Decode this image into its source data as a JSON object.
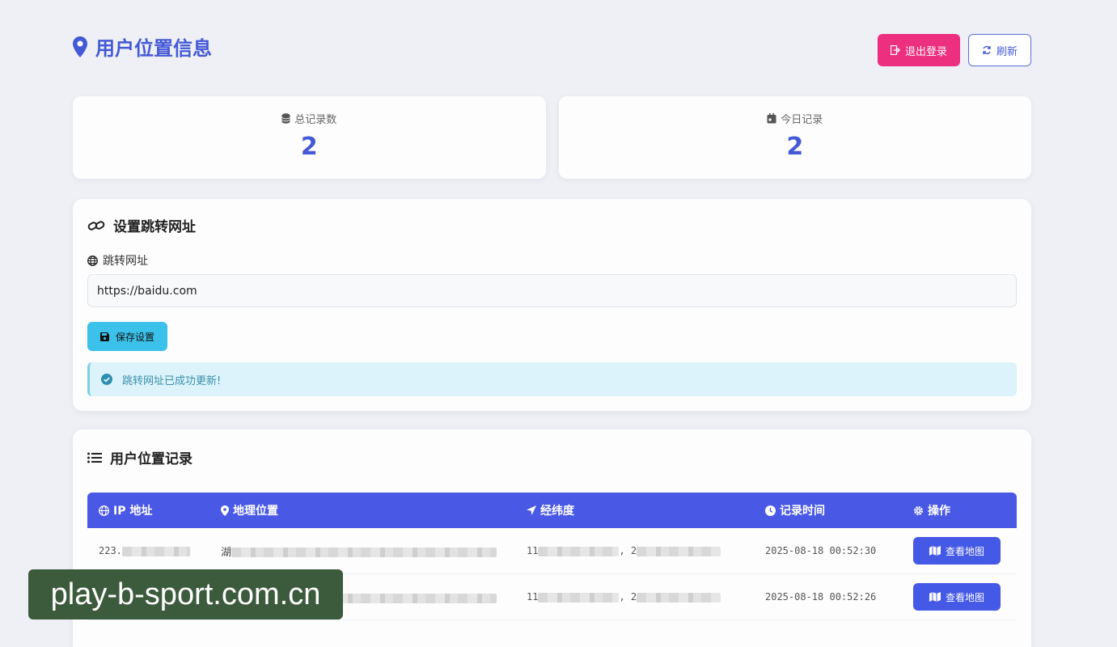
{
  "header": {
    "title": "用户位置信息",
    "logout_label": "退出登录",
    "refresh_label": "刷新"
  },
  "stats": [
    {
      "label": "总记录数",
      "value": "2",
      "icon": "database-icon"
    },
    {
      "label": "今日记录",
      "value": "2",
      "icon": "calendar-icon"
    }
  ],
  "redirect": {
    "title": "设置跳转网址",
    "field_label": "跳转网址",
    "url_value": "https://baidu.com",
    "save_label": "保存设置",
    "alert_text": "跳转网址已成功更新!"
  },
  "records": {
    "title": "用户位置记录",
    "columns": [
      "IP 地址",
      "地理位置",
      "经纬度",
      "记录时间",
      "操作"
    ],
    "rows": [
      {
        "ip": "223.",
        "location": "湖",
        "coords_a": "11",
        "coords_b": ", 2",
        "time": "2025-08-18 00:52:30",
        "action": "查看地图"
      },
      {
        "ip": "",
        "location": "湖",
        "coords_a": "11",
        "coords_b": ", 2",
        "time": "2025-08-18 00:52:26",
        "action": "查看地图"
      }
    ]
  },
  "watermark": "play-b-sport.com.cn",
  "colors": {
    "accent": "#4459d6",
    "logout": "#ec2f7f",
    "save": "#3cc1ea",
    "table_header": "#4a58e6",
    "alert_bg": "#dcf3fb"
  }
}
